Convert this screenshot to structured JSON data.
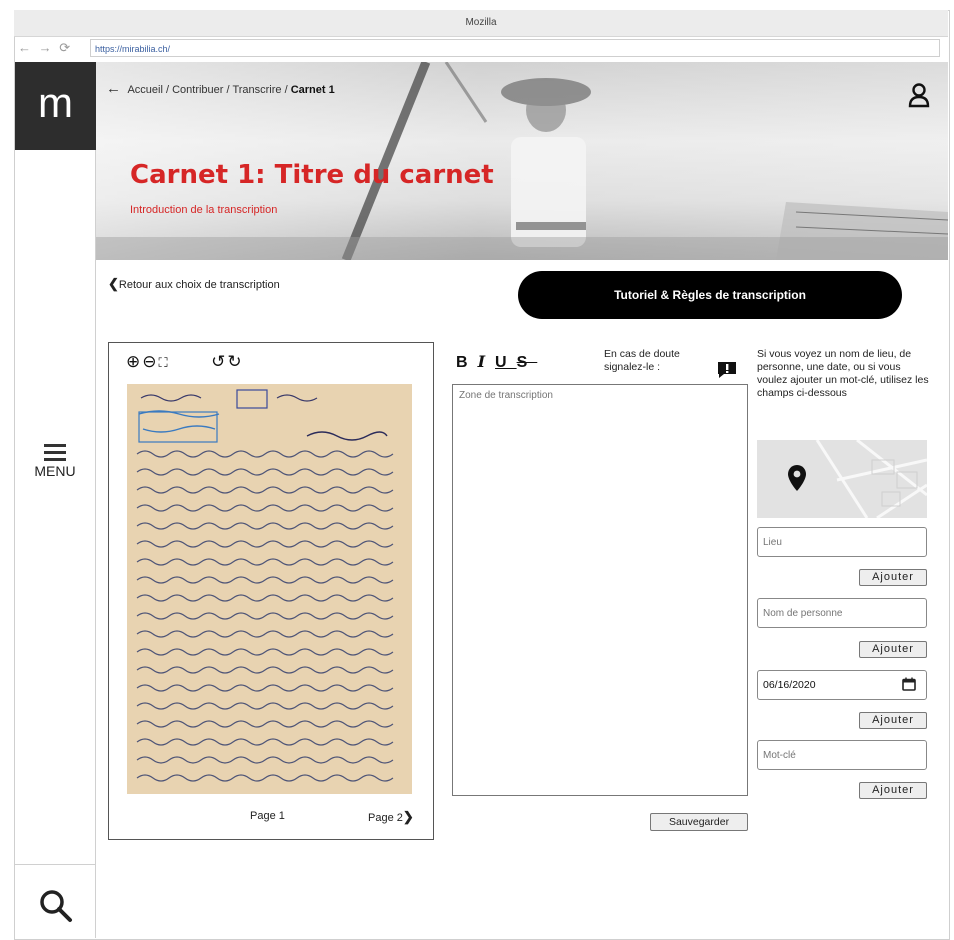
{
  "browser": {
    "window_title": "Mozilla",
    "nav_glyphs": "← → ⟳",
    "url": "https://mirabilia.ch/"
  },
  "rail": {
    "logo_letter": "m",
    "menu_label": "MENU"
  },
  "header": {
    "breadcrumb": [
      "Accueil",
      "Contribuer",
      "Transcrire",
      "Carnet 1"
    ],
    "breadcrumb_sep": " / ",
    "title": "Carnet 1: Titre du carnet",
    "subtitle": "Introduction de la transcription"
  },
  "actions": {
    "back_link": "Retour aux choix de transcription",
    "tutorial_button": "Tutoriel & Règles de transcription"
  },
  "viewer": {
    "tools": "⊕⊖⛶  ↺↻",
    "page_current": "Page 1",
    "page_next": "Page 2"
  },
  "editor": {
    "format_tools": [
      "B",
      "I",
      "U",
      "S"
    ],
    "doubt_text": "En cas de doute signalez-le :",
    "placeholder": "Zone de transcription",
    "save_button": "Sauvegarder"
  },
  "metadata": {
    "info_text": "Si vous voyez un nom de lieu, de personne, une date, ou si vous voulez ajouter un mot-clé, utilisez les champs ci-dessous",
    "place_placeholder": "Lieu",
    "person_placeholder": "Nom de personne",
    "date_value": "06/16/2020",
    "keyword_placeholder": "Mot-clé",
    "add_label": "Ajouter"
  },
  "colors": {
    "accent_red": "#d62626",
    "logo_bg": "#2d2d2d"
  },
  "icons": [
    "back-arrow-icon",
    "user-icon",
    "menu-icon",
    "search-icon",
    "zoom-in-icon",
    "zoom-out-icon",
    "fullscreen-icon",
    "rotate-left-icon",
    "rotate-right-icon",
    "flag-icon",
    "map-pin-icon",
    "calendar-icon",
    "chevron-left-icon",
    "chevron-right-icon"
  ]
}
